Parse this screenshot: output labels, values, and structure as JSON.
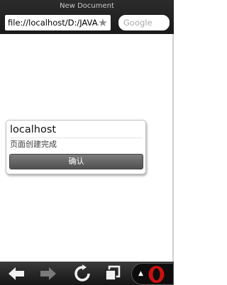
{
  "window": {
    "title": "New Document"
  },
  "address_bar": {
    "url": "file://localhost/D:/JAVA..."
  },
  "search": {
    "placeholder": "Google"
  },
  "dialog": {
    "title": "localhost",
    "message": "页面创建完成",
    "confirm_label": "确认"
  },
  "toolbar": {
    "icons": [
      "back-arrow-icon",
      "forward-arrow-icon",
      "reload-icon",
      "tabs-icon",
      "menu-caret-icon",
      "opera-logo-icon"
    ],
    "accent_color": "#cc1111"
  }
}
